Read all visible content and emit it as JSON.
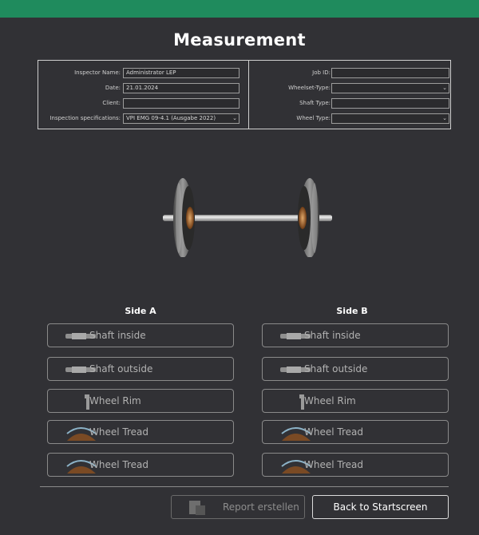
{
  "header": {
    "title": "Measurement",
    "accent_color": "#1f8b5d"
  },
  "form_left": [
    {
      "label": "Inspector Name:",
      "value": "Administrator LEP",
      "type": "text"
    },
    {
      "label": "Date:",
      "value": "21.01.2024",
      "type": "text"
    },
    {
      "label": "Client:",
      "value": "",
      "type": "text"
    },
    {
      "label": "Inspection specifications:",
      "value": "VPI EMG 09-4.1 (Ausgabe 2022)",
      "type": "select"
    }
  ],
  "form_right": [
    {
      "label": "Job ID:",
      "value": "",
      "type": "text"
    },
    {
      "label": "Wheelset-Type:",
      "value": "",
      "type": "select"
    },
    {
      "label": "Shaft Type:",
      "value": "",
      "type": "text"
    },
    {
      "label": "Wheel Type:",
      "value": "",
      "type": "select"
    }
  ],
  "side_a": {
    "title": "Side A",
    "buttons": [
      {
        "label": "Shaft inside",
        "icon": "shaft-icon"
      },
      {
        "label": "Shaft outside",
        "icon": "shaft-icon"
      },
      {
        "label": "Wheel Rim",
        "icon": "wheel-rim-icon"
      },
      {
        "label": "Wheel Tread",
        "icon": "wheel-tread-icon"
      },
      {
        "label": "Wheel Tread",
        "icon": "wheel-tread-icon"
      }
    ]
  },
  "side_b": {
    "title": "Side B",
    "buttons": [
      {
        "label": "Shaft inside",
        "icon": "shaft-icon"
      },
      {
        "label": "Shaft outside",
        "icon": "shaft-icon"
      },
      {
        "label": "Wheel Rim",
        "icon": "wheel-rim-icon"
      },
      {
        "label": "Wheel Tread",
        "icon": "wheel-tread-icon"
      },
      {
        "label": "Wheel Tread",
        "icon": "wheel-tread-icon"
      }
    ]
  },
  "footer": {
    "report_label": "Report erstellen",
    "back_label": "Back to Startscreen"
  }
}
